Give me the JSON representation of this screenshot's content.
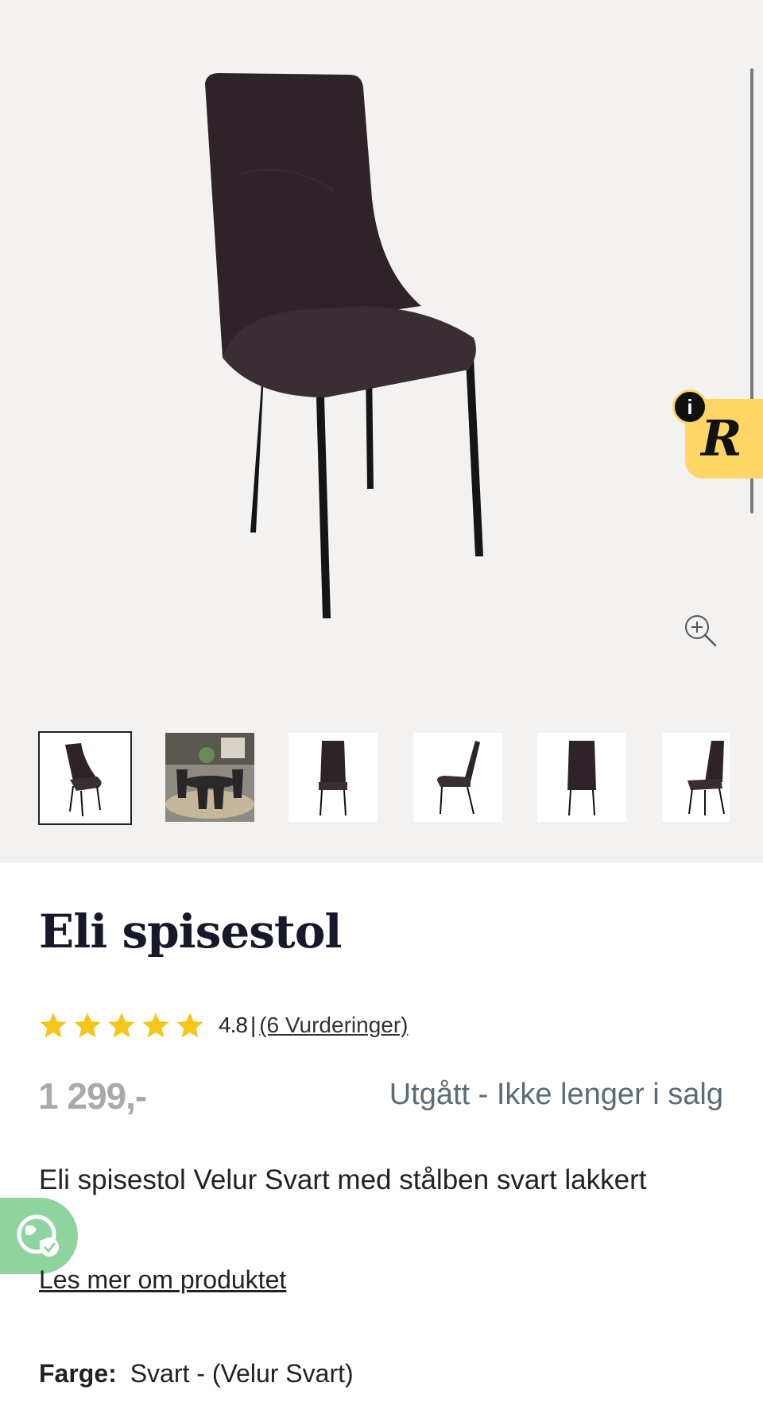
{
  "product": {
    "title": "Eli spisestol",
    "rating_value": "4.8",
    "rating_separator": "|",
    "rating_link": "(6 Vurderinger)",
    "rating_stars": 5,
    "price": "1 299,-",
    "status": "Utgått - Ikke lenger i salg",
    "description": "Eli spisestol Velur Svart med stålben svart lakkert",
    "read_more": "Les mer om produktet",
    "color_label": "Farge:",
    "color_value": "Svart - (Velur Svart)"
  },
  "badges": {
    "info": "i",
    "r_logo": "R"
  },
  "thumbnails": [
    {
      "name": "thumbnail-1",
      "view": "front-angle",
      "active": true
    },
    {
      "name": "thumbnail-2",
      "view": "room-scene",
      "active": false
    },
    {
      "name": "thumbnail-3",
      "view": "front",
      "active": false
    },
    {
      "name": "thumbnail-4",
      "view": "side",
      "active": false
    },
    {
      "name": "thumbnail-5",
      "view": "back",
      "active": false
    },
    {
      "name": "thumbnail-6",
      "view": "angle",
      "active": false
    }
  ],
  "colors": {
    "star": "#f5c518",
    "upholstery": "#2e2328",
    "badge_yellow": "#ffd666",
    "globe_green": "#8fd49f",
    "title": "#17192b",
    "status": "#5d6b75",
    "price": "#a9a9a9"
  }
}
